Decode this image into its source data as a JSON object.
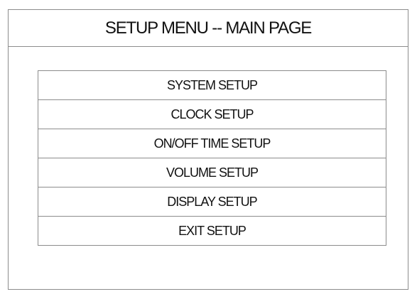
{
  "title": "SETUP MENU -- MAIN PAGE",
  "menu": {
    "items": [
      {
        "label": "SYSTEM SETUP"
      },
      {
        "label": "CLOCK SETUP"
      },
      {
        "label": "ON/OFF TIME SETUP"
      },
      {
        "label": "VOLUME SETUP"
      },
      {
        "label": "DISPLAY SETUP"
      },
      {
        "label": "EXIT SETUP"
      }
    ]
  }
}
